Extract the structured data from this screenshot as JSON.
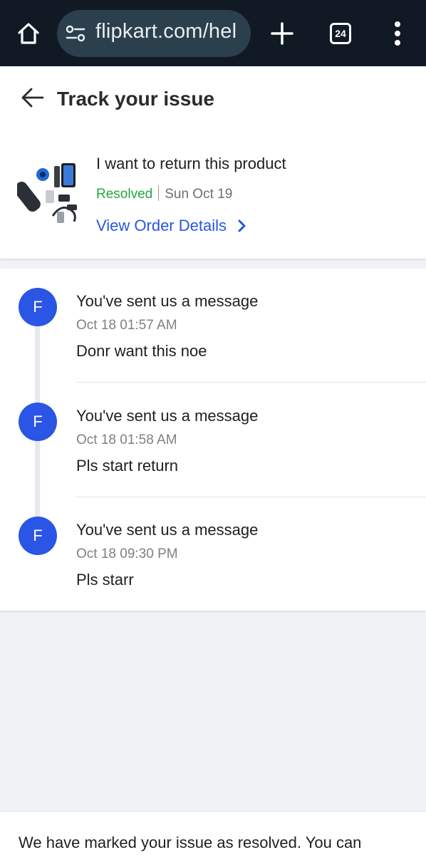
{
  "browser": {
    "url": "flipkart.com/hel",
    "tab_count": "24",
    "icons": [
      "home-icon",
      "site-info-icon",
      "plus-icon",
      "tabs-icon",
      "more-vert-icon"
    ]
  },
  "header": {
    "title": "Track your issue",
    "back_icon": "arrow-left-icon"
  },
  "issue": {
    "title": "I want to return this product",
    "status": "Resolved",
    "date": "Sun Oct 19",
    "view_order_label": "View Order Details",
    "status_color": "#26a541",
    "link_color": "#2a55e5"
  },
  "messages": [
    {
      "avatar": "F",
      "heading": "You've sent us a message",
      "time": "Oct 18 01:57 AM",
      "text": "Donr want this noe"
    },
    {
      "avatar": "F",
      "heading": "You've sent us a message",
      "time": "Oct 18 01:58 AM",
      "text": "Pls start return"
    },
    {
      "avatar": "F",
      "heading": "You've sent us a message",
      "time": "Oct 18 09:30 PM",
      "text": "Pls starr"
    }
  ],
  "footer": {
    "text": "We have marked your issue as resolved. You can"
  },
  "colors": {
    "accent": "#2a55e5",
    "browser_bar": "#111a24",
    "background": "#f1f2f6"
  }
}
